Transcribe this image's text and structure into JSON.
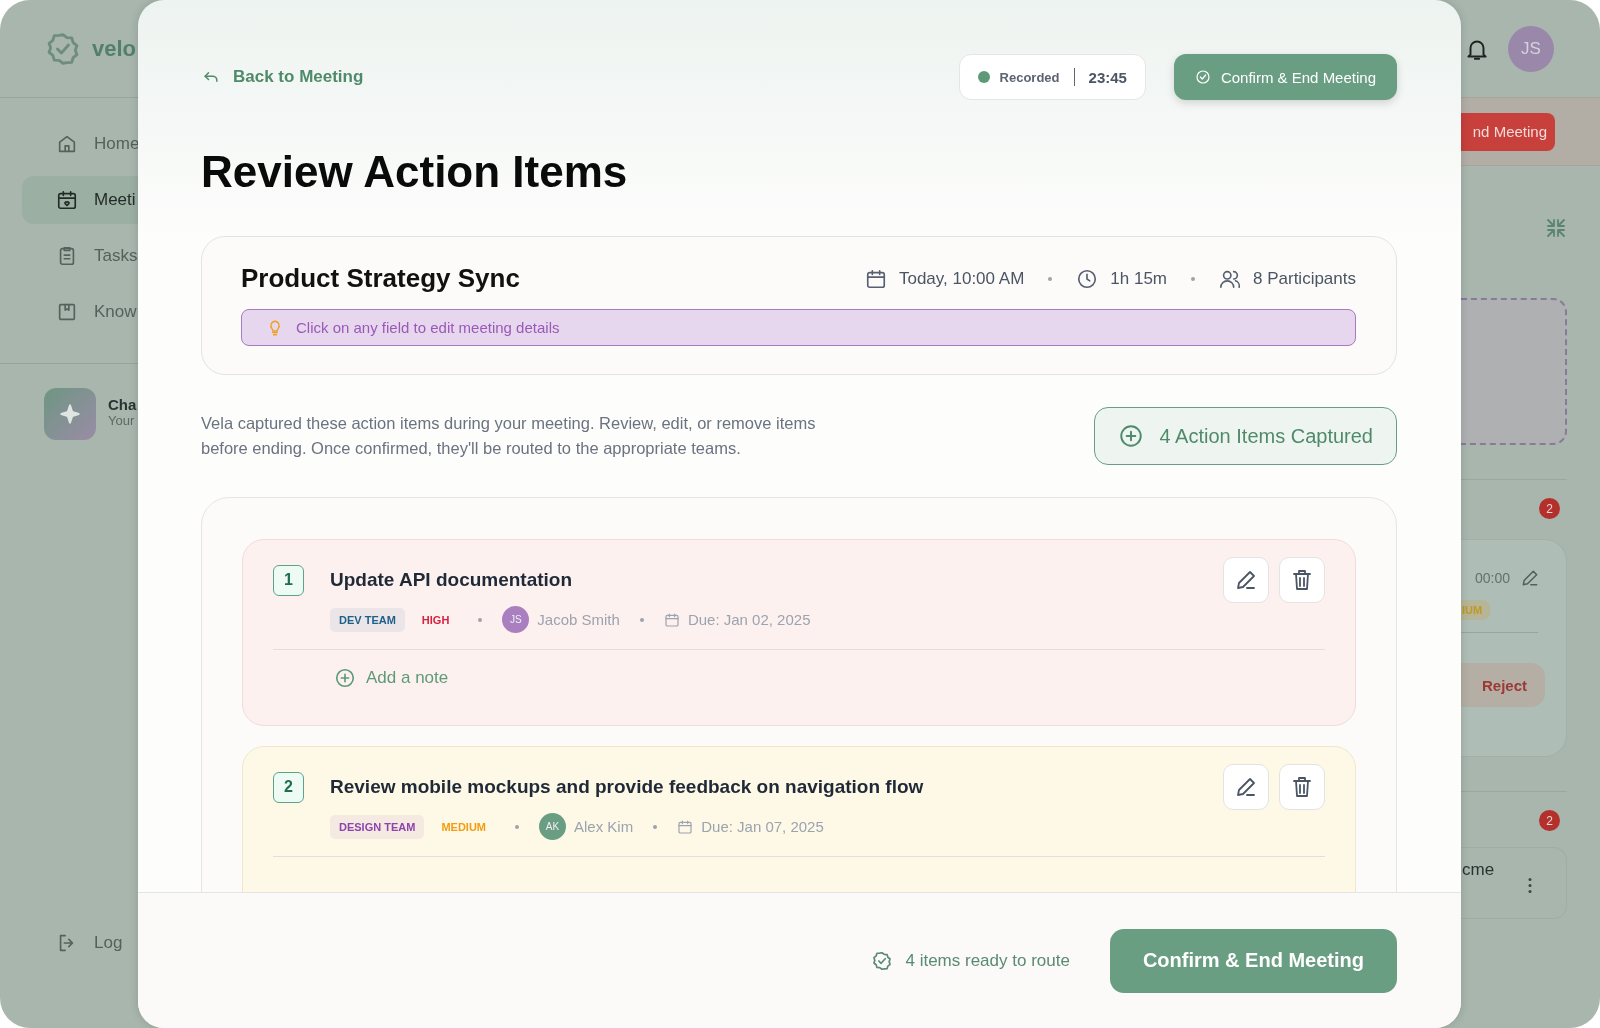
{
  "background": {
    "brand": "velo",
    "nav": [
      {
        "label": "Home",
        "selected": false
      },
      {
        "label": "Meeti",
        "selected": true
      },
      {
        "label": "Tasks",
        "selected": false
      },
      {
        "label": "Know",
        "selected": false
      }
    ],
    "chat": {
      "title": "Cha",
      "subtitle": "Your"
    },
    "logout": "Log",
    "avatar": "JS",
    "end_button": "nd Meeting",
    "badges": [
      "2",
      "2"
    ],
    "card": {
      "time": "00:00",
      "tag": "IUM",
      "button": "Reject"
    },
    "card_2": {
      "text": "cme"
    }
  },
  "modal": {
    "back": "Back to Meeting",
    "recording": {
      "label": "Recorded",
      "time": "23:45",
      "on": true
    },
    "confirm_top": "Confirm & End Meeting",
    "title": "Review Action Items",
    "meeting": {
      "name": "Product Strategy Sync",
      "date": "Today, 10:00 AM",
      "duration": "1h 15m",
      "participants": "8 Participants",
      "hint": "Click on any field to edit meeting details"
    },
    "description": "Vela captured these action items during your meeting. Review, edit, or remove items before ending. Once confirmed, they'll be routed to the appropriate teams.",
    "captured": "4 Action Items Captured",
    "items": [
      {
        "number": "1",
        "title": "Update API documentation",
        "team": {
          "label": "DEV TEAM",
          "color": "#1c5f8a"
        },
        "priority": {
          "label": "HIGH",
          "kind": "high"
        },
        "assignee": {
          "initials": "JS",
          "name": "Jacob Smith",
          "color": "#a97fc0"
        },
        "due": "Due: Jan 02, 2025",
        "note": "Add a note"
      },
      {
        "number": "2",
        "title": "Review mobile mockups and provide feedback on navigation flow",
        "team": {
          "label": "DESIGN TEAM",
          "color": "#8e44ad"
        },
        "priority": {
          "label": "MEDIUM",
          "kind": "medium"
        },
        "assignee": {
          "initials": "AK",
          "name": "Alex Kim",
          "color": "#6a9e82"
        },
        "due": "Due: Jan 07, 2025"
      }
    ],
    "footer": {
      "status": "4 items ready to route",
      "button": "Confirm & End Meeting"
    }
  }
}
